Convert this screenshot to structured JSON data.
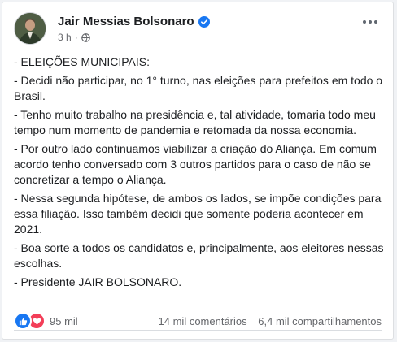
{
  "post": {
    "author": "Jair Messias Bolsonaro",
    "time": "3 h",
    "separator": "·",
    "paragraphs": [
      "- ELEIÇÕES MUNICIPAIS:",
      "- Decidi não participar, no 1° turno, nas eleições para prefeitos em todo o Brasil.",
      "- Tenho muito trabalho na presidência e, tal atividade, tomaria todo meu tempo num momento de pandemia e retomada da nossa economia.",
      "- Por outro lado continuamos viabilizar a criação do Aliança. Em comum acordo tenho conversado com 3 outros partidos para o caso de não se concretizar a tempo o Aliança.",
      "- Nessa segunda hipótese, de ambos os lados, se impõe condições para essa filiação. Isso também decidi que somente poderia acontecer em 2021.",
      "- Boa sorte a todos os candidatos e, principalmente, aos eleitores nessas escolhas.",
      "- Presidente JAIR BOLSONARO."
    ],
    "reactions_count": "95 mil",
    "comments": "14 mil comentários",
    "shares": "6,4 mil compartilhamentos"
  },
  "colors": {
    "like": "#1877f2",
    "love": "#f33e58",
    "text": "#1c1e21",
    "muted": "#65676b"
  },
  "icons": {
    "verified": "verified-badge-icon",
    "globe": "globe-icon",
    "more": "more-options-icon",
    "like": "like-icon",
    "love": "love-icon"
  }
}
